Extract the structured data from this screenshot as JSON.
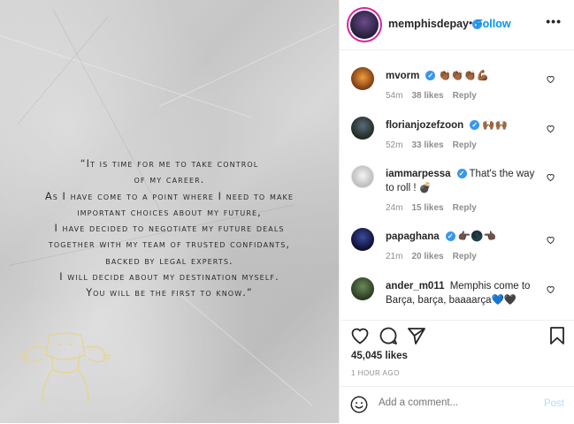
{
  "post": {
    "quote_lines": [
      "“It is time for me to take control",
      "of my career.",
      "As I have come to a point where I need to make",
      "important choices about my future,",
      "I have decided to negotiate my future deals",
      "together with my team of trusted confidants,",
      "backed by legal experts.",
      "I will decide about my destination myself.",
      "You will be the first to know.”"
    ]
  },
  "header": {
    "username": "memphisdepay",
    "verified_mark": "✓",
    "separator": "•",
    "follow_label": "Follow",
    "more_label": "•••"
  },
  "comments": [
    {
      "user": "mvorm",
      "verified": true,
      "text": "👏🏾👏🏾👏🏾💪🏾",
      "age": "54m",
      "likes": "38 likes",
      "reply": "Reply"
    },
    {
      "user": "florianjozefzoon",
      "verified": true,
      "text": "🙌🏾🙌🏾",
      "age": "52m",
      "likes": "33 likes",
      "reply": "Reply"
    },
    {
      "user": "iammarpessa",
      "verified": true,
      "text": "That's the way to roll ! 💣",
      "age": "24m",
      "likes": "15 likes",
      "reply": "Reply"
    },
    {
      "user": "papaghana",
      "verified": true,
      "text": "👉🏿🌑👈🏿",
      "age": "21m",
      "likes": "20 likes",
      "reply": "Reply"
    },
    {
      "user": "ander_m011",
      "verified": false,
      "text": "Memphis come to Barça, barça, baaaarça💙🖤",
      "age": "",
      "likes": "",
      "reply": ""
    }
  ],
  "stats": {
    "likes": "45,045 likes",
    "time": "1 HOUR AGO"
  },
  "composer": {
    "placeholder": "Add a comment...",
    "post_label": "Post"
  },
  "colors": {
    "accent": "#0095f6",
    "verified": "#3897f0",
    "muted": "#8e8e8e",
    "logo_line": "#e9d48a"
  },
  "icons": [
    "heart-icon",
    "comment-icon",
    "share-icon",
    "bookmark-icon",
    "emoji-icon",
    "verified-icon",
    "more-icon"
  ]
}
